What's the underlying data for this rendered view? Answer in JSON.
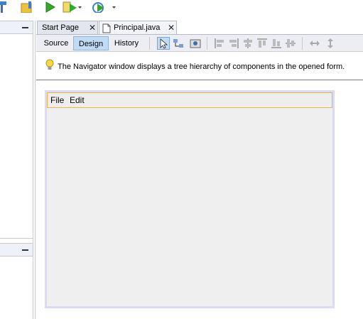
{
  "toolbar": {
    "icons": [
      "hammer-icon",
      "clean-build-icon",
      "run-icon",
      "debug-icon",
      "profile-icon"
    ]
  },
  "editor": {
    "tabs": [
      {
        "label": "Start Page",
        "active": false
      },
      {
        "label": "Principal.java",
        "active": true
      }
    ],
    "view_tabs": [
      {
        "label": "Source",
        "active": false
      },
      {
        "label": "Design",
        "active": true
      },
      {
        "label": "History",
        "active": false
      }
    ],
    "info_message": "The Navigator window displays a tree hierarchy of components in the opened form."
  },
  "form": {
    "menus": [
      "File",
      "Edit"
    ]
  },
  "colors": {
    "accent": "#c2dbf5",
    "menubar_border": "#f2b04d",
    "canvas_border": "#dadaf5"
  }
}
